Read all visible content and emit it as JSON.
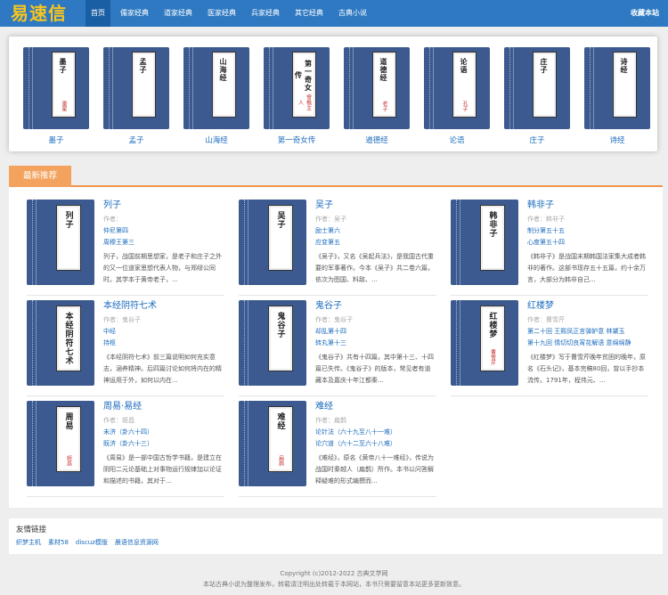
{
  "header": {
    "logo": "易速信",
    "nav": [
      "首页",
      "儒家经典",
      "道家经典",
      "医家经典",
      "兵家经典",
      "其它经典",
      "古典小说"
    ],
    "favorite": "收藏本站"
  },
  "featured": [
    {
      "name": "墨子",
      "cover_title": "墨子",
      "cover_author": "墨翟"
    },
    {
      "name": "孟子",
      "cover_title": "孟子",
      "cover_author": ""
    },
    {
      "name": "山海经",
      "cover_title": "山海经",
      "cover_author": ""
    },
    {
      "name": "第一奇女传",
      "cover_title": "第一奇女传",
      "cover_author": "雪樵主人"
    },
    {
      "name": "道德经",
      "cover_title": "道德经",
      "cover_author": "老子"
    },
    {
      "name": "论语",
      "cover_title": "论语",
      "cover_author": "孔子"
    },
    {
      "name": "庄子",
      "cover_title": "庄子",
      "cover_author": ""
    },
    {
      "name": "诗经",
      "cover_title": "诗经",
      "cover_author": ""
    }
  ],
  "recommend": {
    "heading": "最新推荐",
    "books": [
      {
        "title": "列子",
        "cover_title": "列子",
        "cover_author": "",
        "author": "作者：",
        "ch1": "仲尼第四",
        "ch2": "周穆王第三",
        "desc": "列子，战国前期思想家，是老子和庄子之外的又一位道家思想代表人物，与郑缪公同时。其学本于黄帝老子，..."
      },
      {
        "title": "吴子",
        "cover_title": "吴子",
        "cover_author": "",
        "author": "作者：吴子",
        "ch1": "励士第六",
        "ch2": "应变第五",
        "desc": "《吴子》，又名《吴起兵法》，是我国古代重要的军事著作。今本《吴子》共二卷六篇，依次为图国、料敌、..."
      },
      {
        "title": "韩非子",
        "cover_title": "韩非子",
        "cover_author": "",
        "author": "作者：韩非子",
        "ch1": "制分第五十五",
        "ch2": "心度第五十四",
        "desc": "《韩非子》是战国末期韩国法家集大成者韩非的著作。这部书现存五十五篇，约十余万言，大部分为韩非自己..."
      },
      {
        "title": "本经阴符七术",
        "cover_title": "本经阴符七术",
        "cover_author": "",
        "author": "作者：鬼谷子",
        "ch1": "中经",
        "ch2": "持枢",
        "desc": "《本经阴符七术》前三篇说明如何充实意志，涵养精神。后四篇讨论如何将内在的精神运用于外，如何以内在..."
      },
      {
        "title": "鬼谷子",
        "cover_title": "鬼谷子",
        "cover_author": "",
        "author": "作者：鬼谷子",
        "ch1": "却乱第十四",
        "ch2": "转丸第十三",
        "desc": "《鬼谷子》共有十四篇，其中第十三、十四篇已失传。《鬼谷子》的版本，常见者有道藏本及嘉庆十年江都秦..."
      },
      {
        "title": "红楼梦",
        "cover_title": "红楼梦",
        "cover_author": "曹雪芹",
        "author": "作者：曹雪芹",
        "ch1": "第二十回 王熙凤正言弹妒意 林黛玉",
        "ch2": "第十九回 情切切良宵花解语 意绵绵静",
        "desc": "《红楼梦》写于曹雪芹晚年贫困的晚年，原名《石头记》，基本完稿80回，曾以手抄本流传。1791年，程伟元、..."
      },
      {
        "title": "周易·易经",
        "cover_title": "周易",
        "cover_author": "姬昌",
        "author": "作者：姬昌",
        "ch1": "未济（卦六十四）",
        "ch2": "既济（卦六十三）",
        "desc": "《周易》是一部中国古哲学书籍，是建立在阴阳二元论基础上对事物运行规律加以论证和描述的书籍，其对于..."
      },
      {
        "title": "难经",
        "cover_title": "难经",
        "cover_author": "扁鹊",
        "author": "作者：扁鹊",
        "ch1": "论针法（六十九至八十一难）",
        "ch2": "论穴道（六十二至六十八难）",
        "desc": "《难经》，原名《黄帝八十一难经》，传说为战国时秦越人（扁鹊）所作。本书以问答解释疑难的形式编撰而..."
      }
    ]
  },
  "links": {
    "title": "友情链接",
    "items": [
      "织梦主机",
      "素材58",
      "discuz模版",
      "晨语信息资源网"
    ]
  },
  "footer": {
    "copyright": "Copyright (c)2012-2022 古典文学网",
    "notice": "本站古典小说为整理发布，转载请注明出处转载于本网站，本书只需要留意本站更多更新致意。"
  }
}
